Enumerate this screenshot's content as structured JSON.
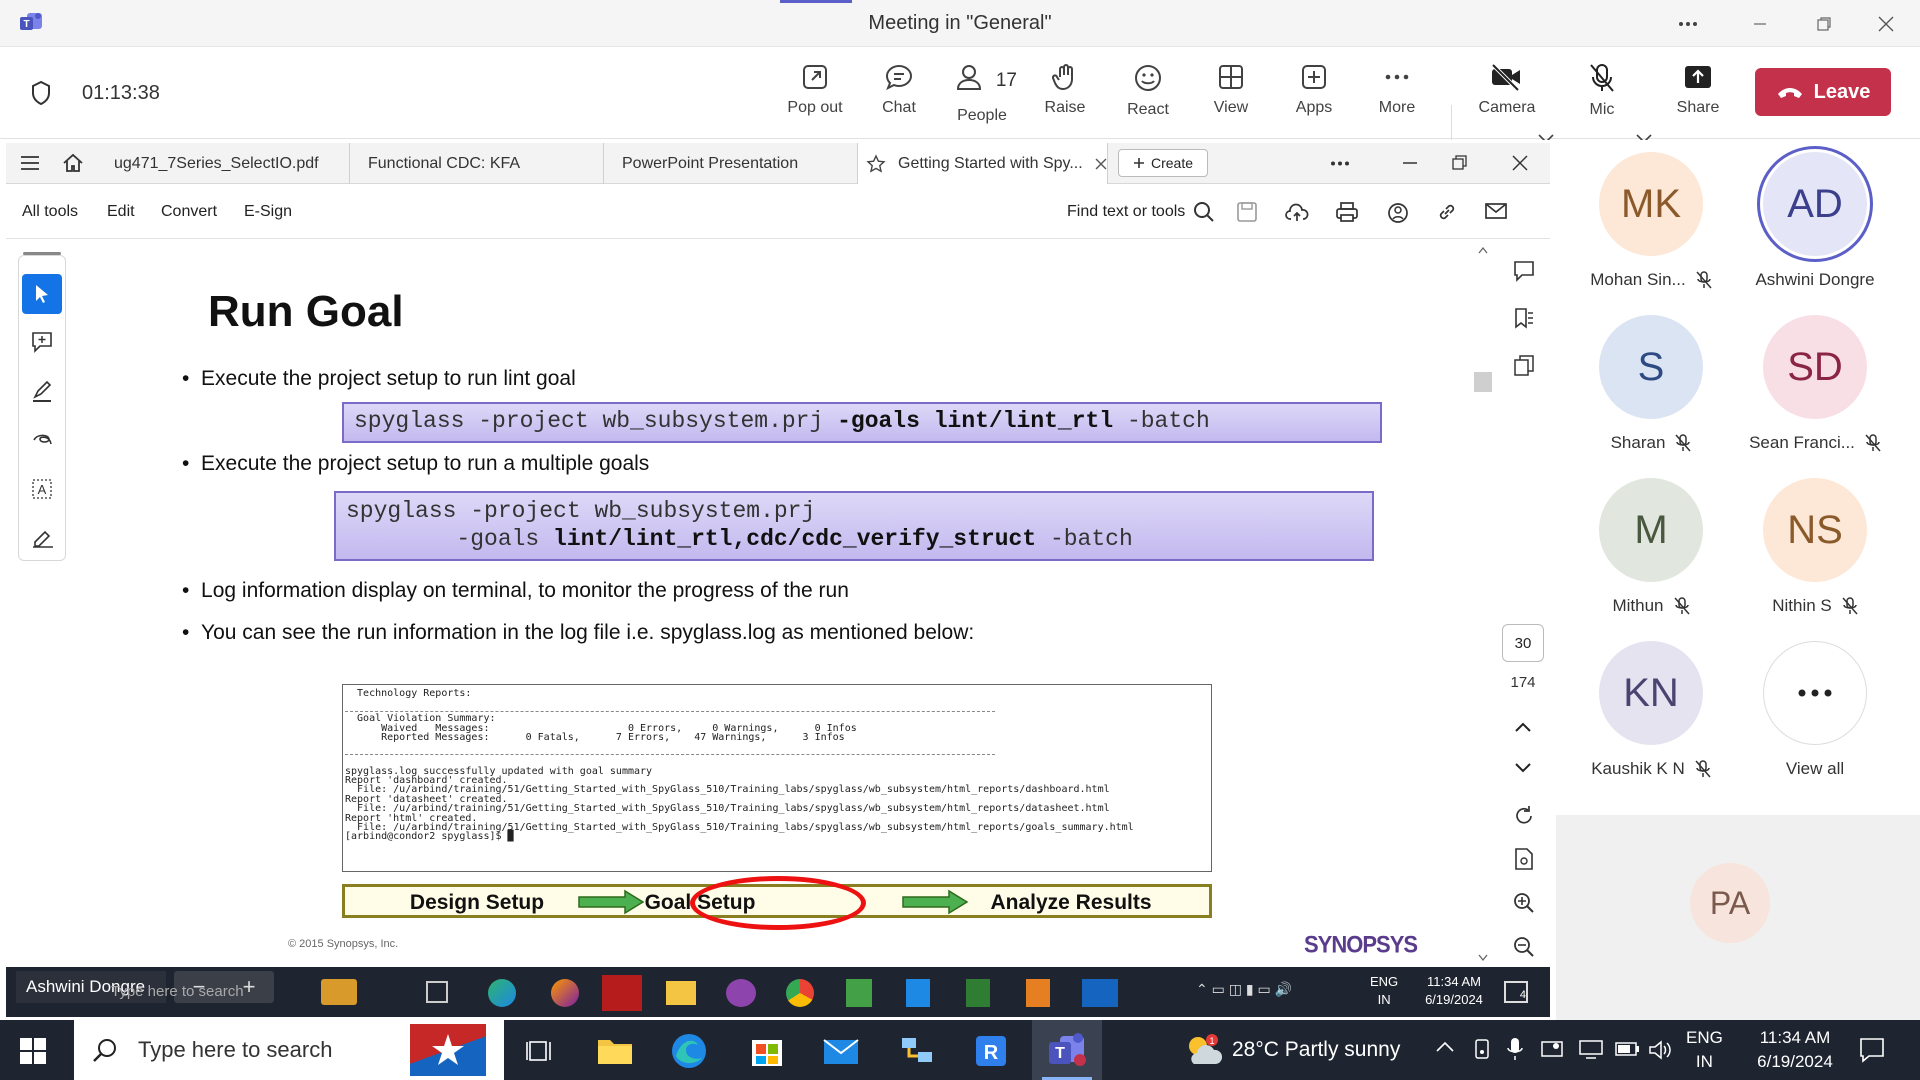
{
  "window": {
    "title": "Meeting in \"General\""
  },
  "meeting": {
    "timer": "01:13:38",
    "tools": [
      {
        "label": "Pop out",
        "icon": "popout-icon"
      },
      {
        "label": "Chat",
        "icon": "chat-icon"
      },
      {
        "label": "People",
        "icon": "people-icon",
        "count": "17"
      },
      {
        "label": "Raise",
        "icon": "raise-hand-icon"
      },
      {
        "label": "React",
        "icon": "react-icon"
      },
      {
        "label": "View",
        "icon": "view-icon"
      },
      {
        "label": "Apps",
        "icon": "apps-icon"
      },
      {
        "label": "More",
        "icon": "more-icon"
      },
      {
        "label": "Camera",
        "icon": "camera-off-icon"
      },
      {
        "label": "Mic",
        "icon": "mic-off-icon"
      },
      {
        "label": "Share",
        "icon": "share-icon"
      }
    ],
    "leave_label": "Leave"
  },
  "acrobat": {
    "tabs": [
      "ug471_7Series_SelectIO.pdf",
      "Functional CDC: KFA",
      "PowerPoint Presentation",
      "Getting Started with Spy..."
    ],
    "create_label": "Create",
    "menu": [
      "All tools",
      "Edit",
      "Convert",
      "E-Sign"
    ],
    "find_label": "Find text or tools",
    "page_current": "30",
    "page_total": "174"
  },
  "slide": {
    "title": "Run Goal",
    "bullet1": "Execute the project setup to run lint goal",
    "cmd1_a": "spyglass -project wb_subsystem.prj ",
    "cmd1_b": "-goals lint/lint_rtl",
    "cmd1_c": " -batch",
    "bullet2": "Execute the project setup to run a multiple goals",
    "cmd2_line1": "spyglass -project wb_subsystem.prj",
    "cmd2_a": "        -goals ",
    "cmd2_b": "lint/lint_rtl,cdc/cdc_verify_struct",
    "cmd2_c": " -batch",
    "bullet3": "Log information display on terminal, to monitor the progress of the run",
    "bullet4": "You can see the run information in the log file i.e. spyglass.log as mentioned below:",
    "terminal": {
      "l1": "  Technology Reports:",
      "l2": "  Goal Violation Summary:",
      "l3": "      Waived   Messages:                       0 Errors,     0 Warnings,      0 Infos",
      "l4": "      Reported Messages:      0 Fatals,      7 Errors,    47 Warnings,      3 Infos",
      "l5": "spyglass.log successfully updated with goal summary",
      "l6": "Report 'dashboard' created.",
      "l7": "  File: /u/arbind/training/51/Getting_Started_with_SpyGlass_510/Training_labs/spyglass/wb_subsystem/html_reports/dashboard.html",
      "l8": "Report 'datasheet' created.",
      "l9": "  File: /u/arbind/training/51/Getting_Started_with_SpyGlass_510/Training_labs/spyglass/wb_subsystem/html_reports/datasheet.html",
      "l10": "Report 'html' created.",
      "l11": "  File: /u/arbind/training/51/Getting_Started_with_SpyGlass_510/Training_labs/spyglass/wb_subsystem/html_reports/goals_summary.html",
      "l12": "[arbind@condor2 spyglass]$ █"
    },
    "flow": [
      "Design Setup",
      "Goal Setup",
      "Analyze Results"
    ],
    "copyright": "© 2015 Synopsys, Inc.",
    "logo": "SYNOPSYS"
  },
  "participants": [
    {
      "initials": "MK",
      "name": "Mohan Sin...",
      "muted": true,
      "bg": "#fde7d6",
      "fg": "#8a5a2b"
    },
    {
      "initials": "AD",
      "name": "Ashwini Dongre",
      "muted": false,
      "bg": "#e4e6f7",
      "fg": "#3b3f8c"
    },
    {
      "initials": "S",
      "name": "Sharan",
      "muted": true,
      "bg": "#dbe4f3",
      "fg": "#2e4a82"
    },
    {
      "initials": "SD",
      "name": "Sean Franci...",
      "muted": true,
      "bg": "#f8dfe6",
      "fg": "#8b2546"
    },
    {
      "initials": "M",
      "name": "Mithun",
      "muted": true,
      "bg": "#e1e6de",
      "fg": "#4a5840"
    },
    {
      "initials": "NS",
      "name": "Nithin S",
      "muted": true,
      "bg": "#fde7d6",
      "fg": "#8a5a2b"
    },
    {
      "initials": "KN",
      "name": "Kaushik K N",
      "muted": true,
      "bg": "#e6e3f1",
      "fg": "#4a4470"
    },
    {
      "initials": "",
      "name": "View all",
      "muted": false,
      "bg": "#ffffff",
      "fg": "#333"
    }
  ],
  "self_view": {
    "initials": "PA"
  },
  "presenter_label": "Ashwini Dongre",
  "inner_taskbar": {
    "search": "Type here to search",
    "lang": "ENG",
    "region": "IN",
    "time": "11:34 AM",
    "date": "6/19/2024",
    "notif": "4"
  },
  "taskbar": {
    "search": "Type here to search",
    "temp": "28°C",
    "weather": "Partly sunny",
    "lang": "ENG",
    "region": "IN",
    "time": "11:34 AM",
    "date": "6/19/2024"
  }
}
